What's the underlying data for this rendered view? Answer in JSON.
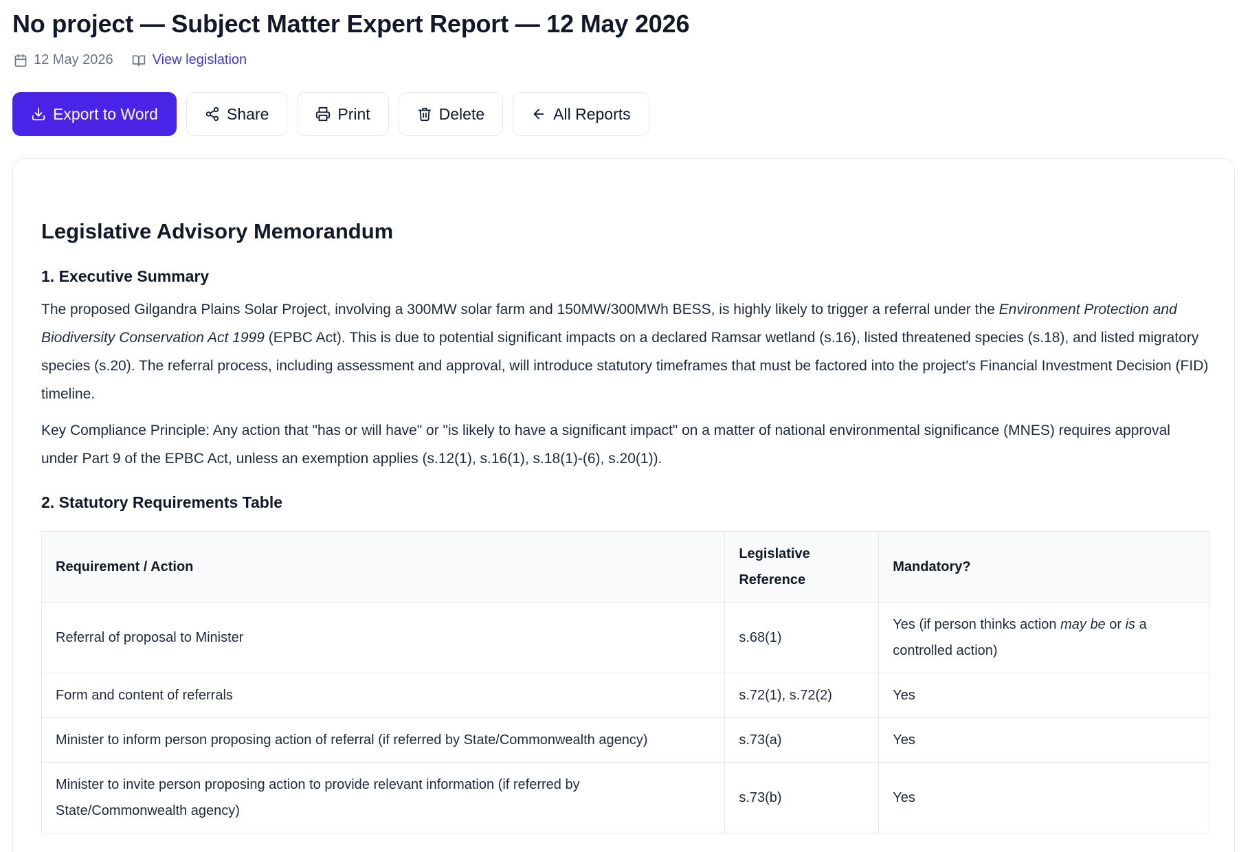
{
  "header": {
    "title": "No project — Subject Matter Expert Report — 12 May 2026",
    "date": "12 May 2026",
    "legislation_link": "View legislation"
  },
  "toolbar": {
    "export_label": "Export to Word",
    "share_label": "Share",
    "print_label": "Print",
    "delete_label": "Delete",
    "all_reports_label": "All Reports"
  },
  "icons": {
    "date": "calendar-icon",
    "legislation": "book-open-icon",
    "export": "download-icon",
    "share": "share-icon",
    "print": "printer-icon",
    "delete": "trash-icon",
    "back": "arrow-left-icon"
  },
  "colors": {
    "accent": "#4a24e6",
    "link": "#4338ca"
  },
  "memo": {
    "heading": "Legislative Advisory Memorandum",
    "section1": {
      "heading": "1. Executive Summary",
      "p1_pre": "The proposed Gilgandra Plains Solar Project, involving a 300MW solar farm and 150MW/300MWh BESS, is highly likely to trigger a referral under the ",
      "p1_em": "Environment Protection and Biodiversity Conservation Act 1999",
      "p1_post": " (EPBC Act). This is due to potential significant impacts on a declared Ramsar wetland (s.16), listed threatened species (s.18), and listed migratory species (s.20). The referral process, including assessment and approval, will introduce statutory timeframes that must be factored into the project's Financial Investment Decision (FID) timeline.",
      "p2": "Key Compliance Principle: Any action that \"has or will have\" or \"is likely to have a significant impact\" on a matter of national environmental significance (MNES) requires approval under Part 9 of the EPBC Act, unless an exemption applies (s.12(1), s.16(1), s.18(1)-(6), s.20(1))."
    },
    "section2": {
      "heading": "2. Statutory Requirements Table",
      "columns": [
        "Requirement / Action",
        "Legislative Reference",
        "Mandatory?"
      ],
      "rows": [
        {
          "requirement": "Referral of proposal to Minister",
          "reference": "s.68(1)",
          "mandatory_pre": "Yes (if person thinks action ",
          "mandatory_em1": "may be",
          "mandatory_mid": " or ",
          "mandatory_em2": "is",
          "mandatory_post": " a controlled action)"
        },
        {
          "requirement": "Form and content of referrals",
          "reference": "s.72(1), s.72(2)",
          "mandatory": "Yes"
        },
        {
          "requirement": "Minister to inform person proposing action of referral (if referred by State/Commonwealth agency)",
          "reference": "s.73(a)",
          "mandatory": "Yes"
        },
        {
          "requirement": "Minister to invite person proposing action to provide relevant information (if referred by State/Commonwealth agency)",
          "reference": "s.73(b)",
          "mandatory": "Yes"
        }
      ]
    }
  }
}
